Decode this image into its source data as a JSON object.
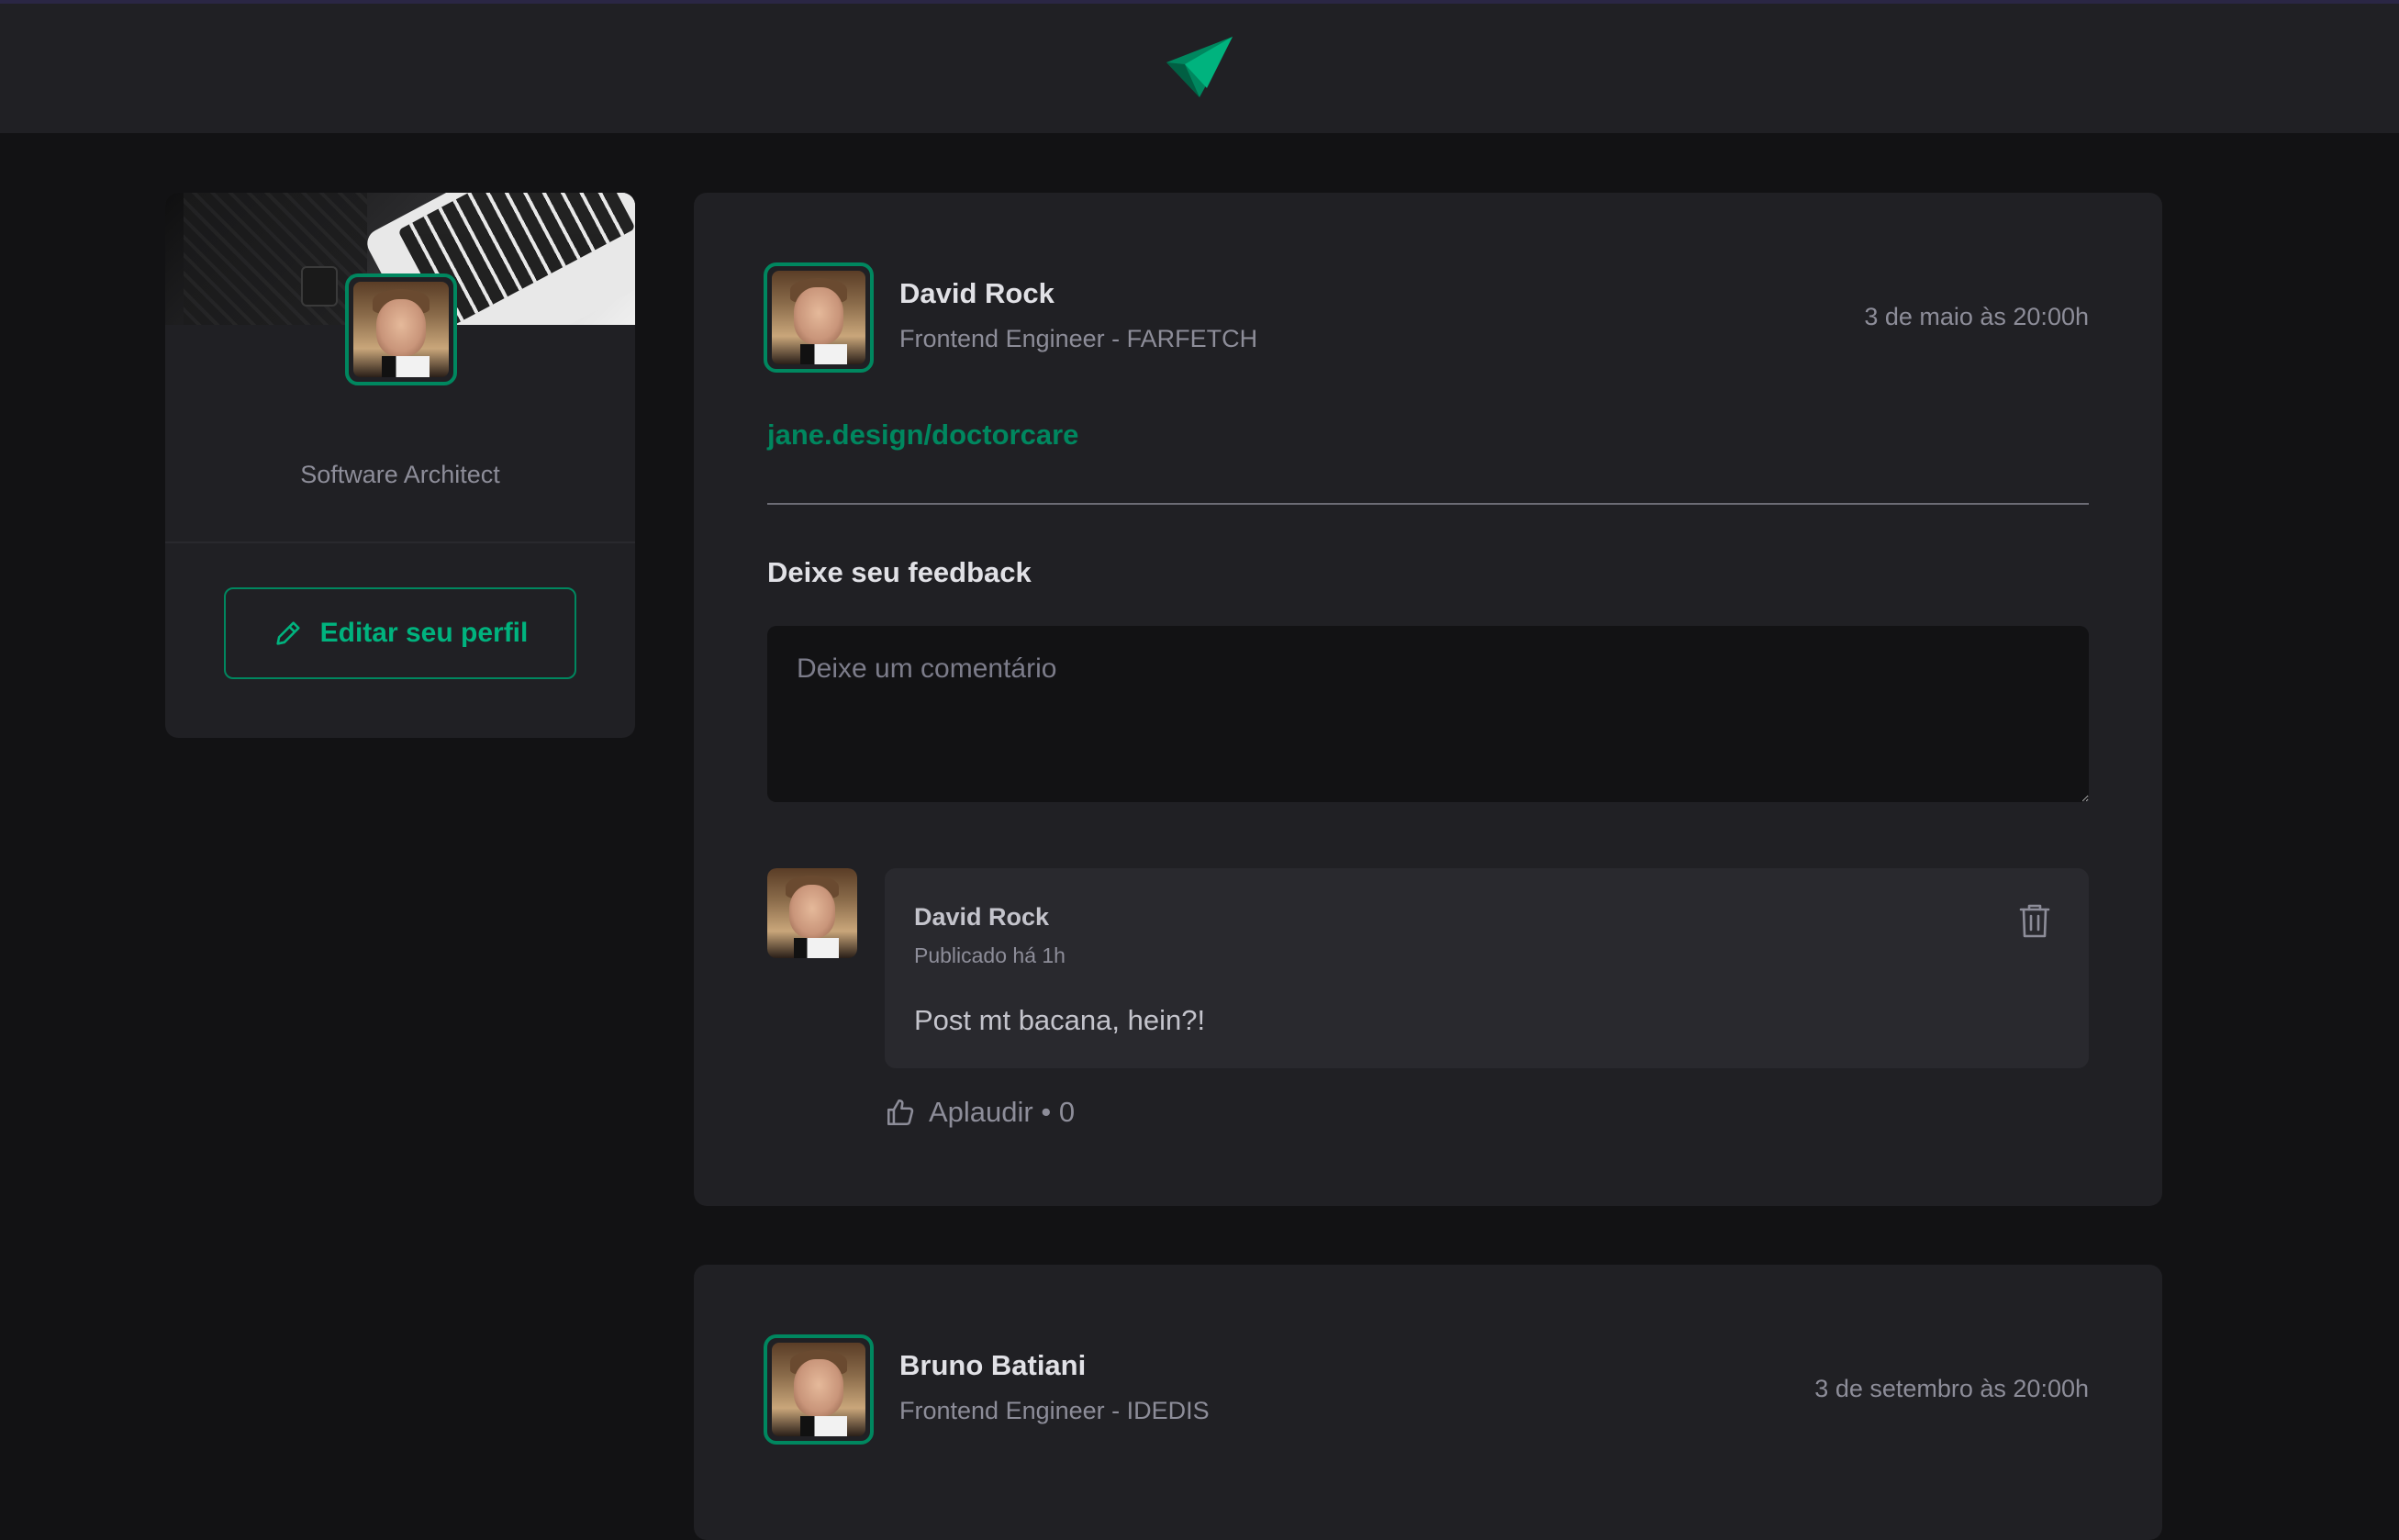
{
  "header": {
    "logo_icon": "paper-plane-icon"
  },
  "sidebar": {
    "role": "Software Architect",
    "edit_button_label": "Editar seu perfil",
    "edit_icon": "pencil-icon"
  },
  "posts": [
    {
      "author": {
        "name": "David Rock",
        "role": "Frontend Engineer - FARFETCH"
      },
      "date": "3 de maio às 20:00h",
      "link": "jane.design/doctorcare",
      "feedback_title": "Deixe seu feedback",
      "comment_placeholder": "Deixe um comentário",
      "comments": [
        {
          "author": "David Rock",
          "time": "Publicado há 1h",
          "text": "Post mt bacana, hein?!",
          "applaud_label": "Aplaudir • 0"
        }
      ]
    },
    {
      "author": {
        "name": "Bruno Batiani",
        "role": "Frontend Engineer - IDEDIS"
      },
      "date": "3 de setembro às 20:00h"
    }
  ],
  "colors": {
    "accent": "#00875F",
    "accent_light": "#00B37E",
    "background": "#121214",
    "surface": "#202024"
  }
}
